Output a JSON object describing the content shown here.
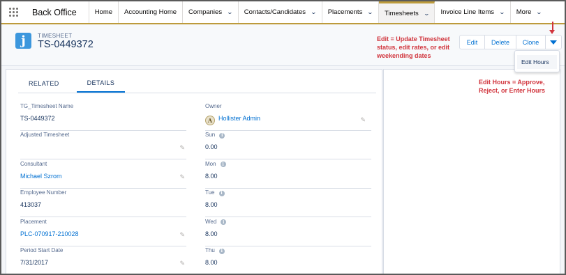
{
  "nav": {
    "app_name": "Back Office",
    "tabs": [
      {
        "label": "Home",
        "has_menu": false
      },
      {
        "label": "Accounting Home",
        "has_menu": false
      },
      {
        "label": "Companies",
        "has_menu": true
      },
      {
        "label": "Contacts/Candidates",
        "has_menu": true
      },
      {
        "label": "Placements",
        "has_menu": true
      },
      {
        "label": "Timesheets",
        "has_menu": true,
        "active": true
      },
      {
        "label": "Invoice Line Items",
        "has_menu": true
      },
      {
        "label": "More",
        "has_menu": true
      }
    ]
  },
  "record": {
    "object_label": "TIMESHEET",
    "title": "TS-0449372",
    "icon_letter": "j",
    "actions": {
      "edit": "Edit",
      "delete": "Delete",
      "clone": "Clone"
    },
    "dropdown": {
      "item": "Edit Hours"
    }
  },
  "annotations": {
    "edit_note": "Edit = Update Timesheet status, edit rates, or edit weekending dates",
    "hours_note": "Edit Hours = Approve, Reject, or Enter Hours"
  },
  "detail_tabs": {
    "related": "RELATED",
    "details": "DETAILS"
  },
  "fields_left": [
    {
      "label": "TG_Timesheet Name",
      "value": "TS-0449372",
      "link": false,
      "editable": false
    },
    {
      "label": "Adjusted Timesheet",
      "value": "",
      "link": false,
      "editable": true
    },
    {
      "label": "Consultant",
      "value": "Michael Szrom",
      "link": true,
      "editable": true
    },
    {
      "label": "Employee Number",
      "value": "413037",
      "link": false,
      "editable": false
    },
    {
      "label": "Placement",
      "value": "PLC-070917-210028",
      "link": true,
      "editable": true
    },
    {
      "label": "Period Start Date",
      "value": "7/31/2017",
      "link": false,
      "editable": true
    }
  ],
  "owner": {
    "label": "Owner",
    "value": "Hollister Admin",
    "avatar_letter": "A"
  },
  "fields_right": [
    {
      "label": "Sun",
      "value": "0.00"
    },
    {
      "label": "Mon",
      "value": "8.00"
    },
    {
      "label": "Tue",
      "value": "8.00"
    },
    {
      "label": "Wed",
      "value": "8.00"
    },
    {
      "label": "Thu",
      "value": "8.00"
    }
  ],
  "colors": {
    "accent": "#bd9b3c",
    "link": "#0070d2",
    "annotation": "#d1343c",
    "icon": "#3c97dd"
  }
}
